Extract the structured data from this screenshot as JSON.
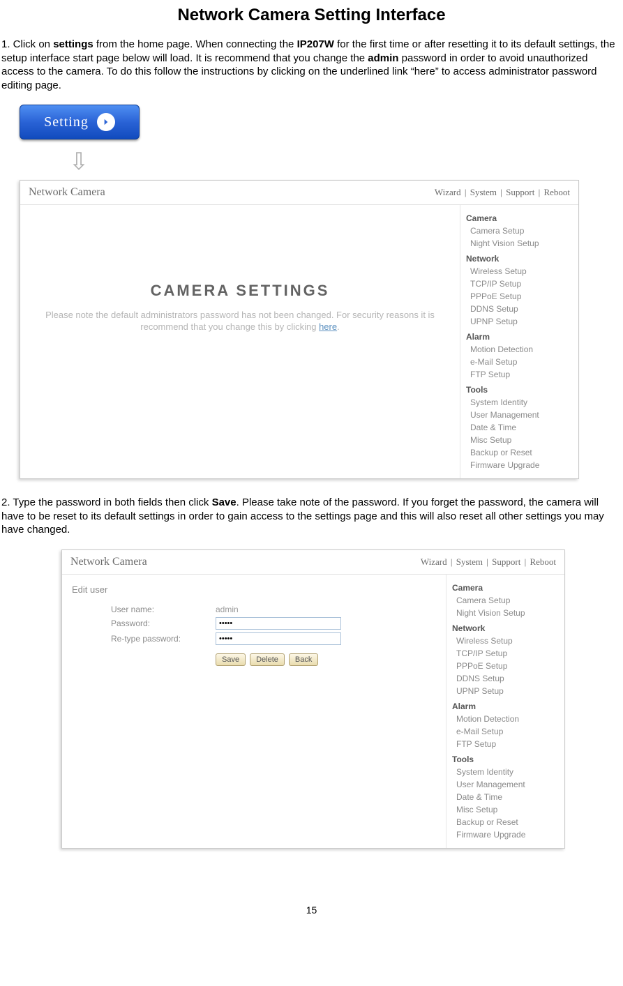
{
  "title": "Network Camera Setting Interface",
  "para1_parts": {
    "p1": "1. Click on ",
    "p2": "settings",
    "p3": " from the home page. When connecting the ",
    "p4": "IP207W",
    "p5": " for the first time or after resetting it to its default settings, the setup interface start page below will load. It is recommend that you change the ",
    "p6": "admin",
    "p7": " password in order to avoid unauthorized access to the camera. To do this follow the instructions by clicking on the underlined link “here” to access administrator password editing page."
  },
  "setting_button_label": "Setting",
  "app": {
    "brand": "Network Camera",
    "top_links": {
      "l1": "Wizard",
      "l2": "System",
      "l3": "Support",
      "l4": "Reboot"
    },
    "sidebar": {
      "groups": [
        {
          "title": "Camera",
          "items": [
            "Camera Setup",
            "Night Vision Setup"
          ]
        },
        {
          "title": "Network",
          "items": [
            "Wireless Setup",
            "TCP/IP Setup",
            "PPPoE Setup",
            "DDNS Setup",
            "UPNP Setup"
          ]
        },
        {
          "title": "Alarm",
          "items": [
            "Motion Detection",
            "e-Mail Setup",
            "FTP Setup"
          ]
        },
        {
          "title": "Tools",
          "items": [
            "System Identity",
            "User Management",
            "Date & Time",
            "Misc Setup",
            "Backup or Reset",
            "Firmware Upgrade"
          ]
        }
      ]
    }
  },
  "screenshot1": {
    "heading": "CAMERA SETTINGS",
    "note_a": "Please note the default administrators password has not been changed. For security reasons it is recommend that you change this by clicking ",
    "note_link": "here",
    "note_b": "."
  },
  "para2_parts": {
    "p1": "2. Type the password in both fields then click ",
    "p2": "Save",
    "p3": ". Please take note of the password. If you forget the password, the camera will have to be reset to its default settings in order to gain access to the settings page and this will also reset all other settings you may have changed."
  },
  "screenshot2": {
    "form_title": "Edit user",
    "rows": {
      "username_label": "User name:",
      "username_value": "admin",
      "password_label": "Password:",
      "password_value": "•••••",
      "retype_label": "Re-type password:",
      "retype_value": "•••••"
    },
    "buttons": {
      "save": "Save",
      "delete": "Delete",
      "back": "Back"
    }
  },
  "page_number": "15"
}
